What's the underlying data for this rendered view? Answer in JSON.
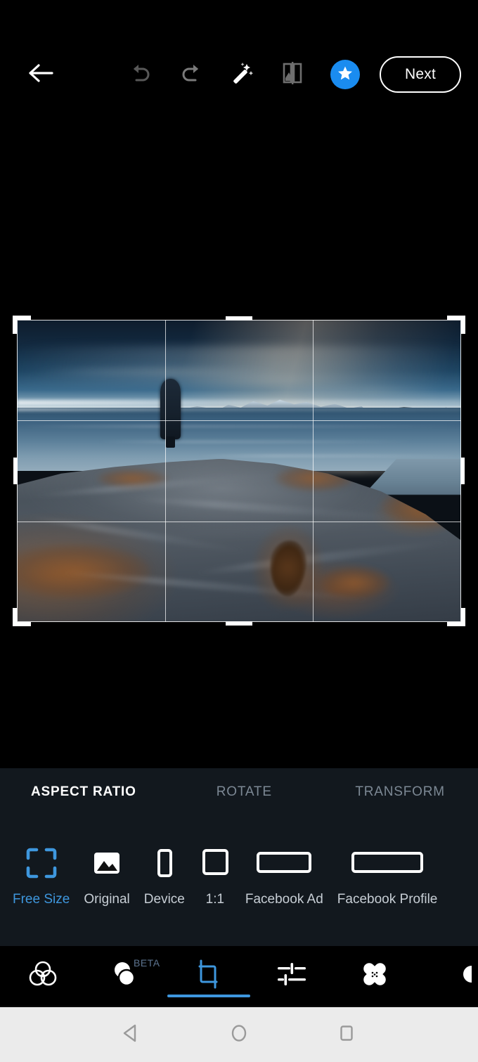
{
  "app": {
    "screen_title": "Photo Editor - Crop",
    "background_color": "#000000",
    "accent_color": "#3e97de",
    "panel_color": "#12181e"
  },
  "topbar": {
    "back_icon": "arrow-left-icon",
    "undo_icon": "undo-icon",
    "redo_icon": "redo-icon",
    "auto_enhance_icon": "magic-wand-icon",
    "compare_icon": "compare-before-after-icon",
    "premium_icon": "star-icon",
    "premium_badge_color": "#1a8cf0",
    "next_label": "Next"
  },
  "canvas": {
    "crop_overlay": {
      "grid": "rule-of-thirds",
      "handles": [
        "top-left",
        "top-right",
        "bottom-left",
        "bottom-right",
        "top",
        "bottom",
        "left",
        "right"
      ]
    },
    "photo_description": "Person standing on a rocky coastal outcrop looking out over the sea toward snow-capped mountains under a dark blue sky"
  },
  "panel": {
    "tabs": [
      {
        "label": "ASPECT RATIO",
        "active": true
      },
      {
        "label": "ROTATE",
        "active": false
      },
      {
        "label": "TRANSFORM",
        "active": false
      }
    ],
    "ratios": [
      {
        "label": "Free Size",
        "icon": "free-size-brackets-icon",
        "selected": true
      },
      {
        "label": "Original",
        "icon": "original-image-icon",
        "selected": false
      },
      {
        "label": "Device",
        "icon": "device-portrait-icon",
        "selected": false
      },
      {
        "label": "1:1",
        "icon": "square-icon",
        "selected": false
      },
      {
        "label": "Facebook Ad",
        "icon": "wide-rectangle-icon",
        "selected": false
      },
      {
        "label": "Facebook Profile",
        "icon": "wide-rectangle-icon",
        "selected": false
      }
    ]
  },
  "toolbar": {
    "tools": [
      {
        "name": "looks-filters",
        "icon": "three-circles-icon",
        "active": false,
        "badge": ""
      },
      {
        "name": "portrait-blur",
        "icon": "two-circles-icon",
        "active": false,
        "badge": "BETA"
      },
      {
        "name": "crop",
        "icon": "crop-icon",
        "active": true,
        "badge": ""
      },
      {
        "name": "adjust",
        "icon": "sliders-icon",
        "active": false,
        "badge": ""
      },
      {
        "name": "heal",
        "icon": "bandage-icon",
        "active": false,
        "badge": ""
      },
      {
        "name": "more",
        "icon": "partial-icon",
        "active": false,
        "badge": ""
      }
    ]
  },
  "androidnav": {
    "back_icon": "triangle-back-icon",
    "home_icon": "circle-home-icon",
    "recents_icon": "square-recents-icon",
    "background_color": "#ebebeb"
  }
}
